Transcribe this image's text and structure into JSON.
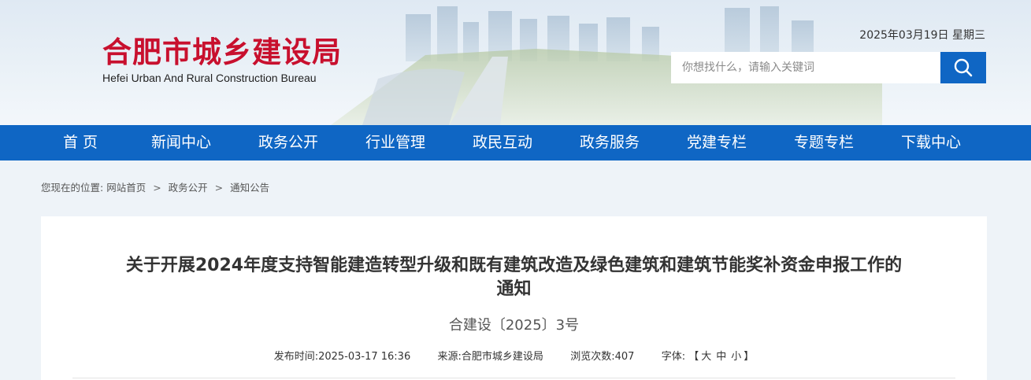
{
  "header": {
    "logo_cn": "合肥市城乡建设局",
    "logo_en": "Hefei Urban And Rural Construction Bureau",
    "date": "2025年03月19日 星期三",
    "search_placeholder": "你想找什么，请输入关键词",
    "search_icon": "search-icon"
  },
  "colors": {
    "brand_blue": "#0f66c4",
    "logo_red": "#c8102e"
  },
  "nav": {
    "items": [
      "首 页",
      "新闻中心",
      "政务公开",
      "行业管理",
      "政民互动",
      "政务服务",
      "党建专栏",
      "专题专栏",
      "下载中心"
    ]
  },
  "breadcrumb": {
    "prefix": "您现在的位置:",
    "sep": ">",
    "items": [
      "网站首页",
      "政务公开",
      "通知公告"
    ]
  },
  "article": {
    "title_line1": "关于开展2024年度支持智能建造转型升级和既有建筑改造及绿色建筑和建筑节能奖补资金申报工作的",
    "title_line2": "通知",
    "doc_number": "合建设〔2025〕3号",
    "publish_label": "发布时间:",
    "publish_time": "2025-03-17 16:36",
    "source_label": "来源:",
    "source": "合肥市城乡建设局",
    "views_label": "浏览次数:",
    "views": "407",
    "font_label": "字体:",
    "bracket_open": "【",
    "font_large": "大",
    "font_medium": "中",
    "font_small": "小",
    "bracket_close": "】"
  }
}
